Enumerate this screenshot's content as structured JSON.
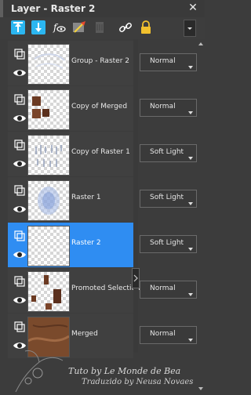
{
  "panel": {
    "title": "Layer - Raster 2",
    "close_glyph": "✕",
    "toolbar": [
      {
        "icon": "new-raster-layer-icon"
      },
      {
        "icon": "new-vector-layer-icon"
      },
      {
        "icon": "new-mask-layer-icon"
      },
      {
        "icon": "new-adjustment-layer-icon"
      },
      {
        "icon": "delete-layer-icon"
      },
      {
        "icon": "link-layers-icon"
      },
      {
        "icon": "lock-icon"
      }
    ],
    "toolbar_menu_icon": "dropdown-arrow-icon"
  },
  "layers": [
    {
      "name": "Group - Raster 2",
      "blend": "Normal",
      "selected": false,
      "visible": true,
      "thumb": "group"
    },
    {
      "name": "Copy of Merged",
      "blend": "Normal",
      "selected": false,
      "visible": true,
      "thumb": "copy-merged"
    },
    {
      "name": "Copy of Raster 1",
      "blend": "Soft Light",
      "selected": false,
      "visible": true,
      "thumb": "copy-raster1"
    },
    {
      "name": "Raster 1",
      "blend": "Soft Light",
      "selected": false,
      "visible": true,
      "thumb": "raster1"
    },
    {
      "name": "Raster 2",
      "blend": "Soft Light",
      "selected": true,
      "visible": true,
      "thumb": "raster2"
    },
    {
      "name": "Promoted Selection",
      "blend": "Normal",
      "selected": false,
      "visible": true,
      "thumb": "promoted"
    },
    {
      "name": "Merged",
      "blend": "Normal",
      "selected": false,
      "visible": true,
      "thumb": "merged"
    }
  ],
  "watermark": {
    "line1": "Tuto by Le Monde de Bea",
    "line2": "Traduzido by Neusa Novaes"
  },
  "colors": {
    "selected_row": "#2f8df2",
    "panel_bg": "#3c3c3c"
  }
}
